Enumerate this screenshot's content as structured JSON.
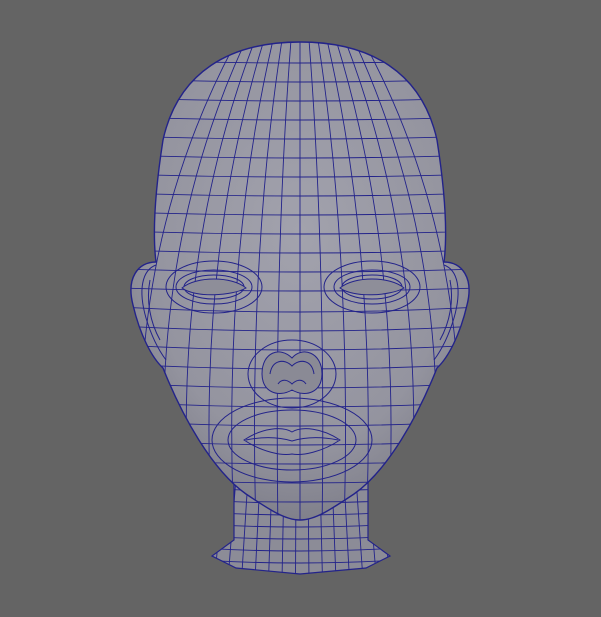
{
  "viewport": {
    "background_color": "#646464",
    "mesh_fill_color": "#9b9ba6",
    "mesh_shadow_color": "#7b7b86",
    "wireframe_color": "#23238a",
    "selection_mode": "wireframe-on-shaded"
  },
  "model": {
    "subject": "head-mesh",
    "parts": [
      "skull",
      "face",
      "ears",
      "eyes",
      "nose",
      "mouth",
      "neck"
    ]
  }
}
